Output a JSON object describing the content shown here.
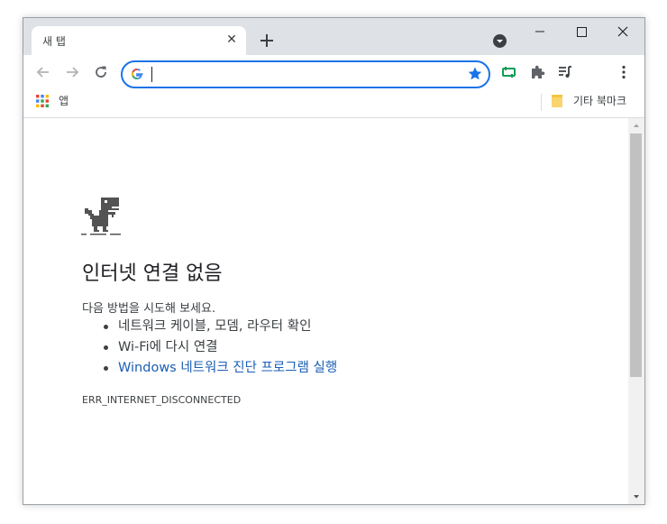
{
  "tab": {
    "title": "새 탭",
    "close_glyph": "✕"
  },
  "omnibox": {
    "value": "",
    "placeholder": ""
  },
  "bookmarks": {
    "apps_label": "앱",
    "other_label": "기타 북마크"
  },
  "error": {
    "title": "인터넷 연결 없음",
    "subtitle": "다음 방법을 시도해 보세요.",
    "suggestions": [
      "네트워크 케이블, 모뎀, 라우터 확인",
      "Wi-Fi에 다시 연결",
      "Windows 네트워크 진단 프로그램 실행"
    ],
    "code": "ERR_INTERNET_DISCONNECTED"
  },
  "icons": {
    "back": "arrow-left-icon",
    "forward": "arrow-right-icon",
    "reload": "reload-icon",
    "star": "star-icon",
    "extension": "puzzle-icon",
    "media": "media-queue-icon",
    "menu": "kebab-menu-icon"
  },
  "colors": {
    "accent": "#1a73e8",
    "link": "#1a5fb4",
    "tab_strip": "#dee1e6",
    "text": "#3c4043"
  }
}
